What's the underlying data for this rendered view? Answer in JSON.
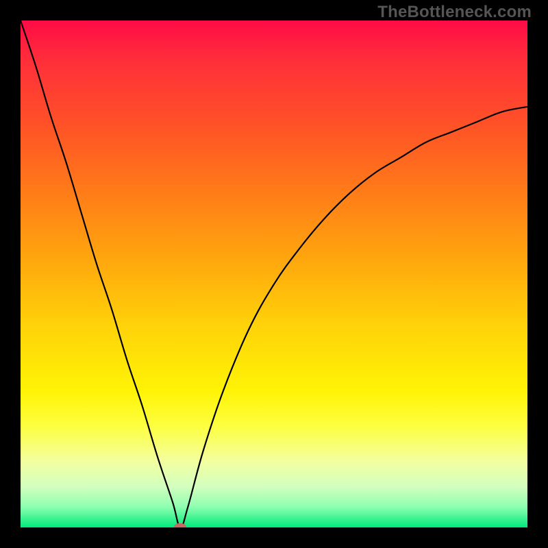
{
  "watermark": "TheBottleneck.com",
  "colors": {
    "frame": "#000000",
    "curve": "#000000",
    "marker": "#c46b62",
    "gradient_top": "#ff0b46",
    "gradient_bottom": "#00e97a"
  },
  "chart_data": {
    "type": "line",
    "title": "",
    "xlabel": "",
    "ylabel": "",
    "xlim": [
      0,
      100
    ],
    "ylim": [
      0,
      100
    ],
    "grid": false,
    "legend": null,
    "annotations": [
      {
        "text": "TheBottleneck.com",
        "position": "top-right"
      }
    ],
    "series": [
      {
        "name": "bottleneck-curve",
        "x": [
          0,
          3,
          6,
          9,
          12,
          15,
          18,
          21,
          24,
          27,
          30,
          31.5,
          33,
          36,
          40,
          45,
          50,
          55,
          60,
          65,
          70,
          75,
          80,
          85,
          90,
          95,
          100
        ],
        "values": [
          100,
          91,
          81,
          72,
          62,
          52,
          43,
          33,
          24,
          14,
          5,
          0,
          4,
          15,
          27,
          39,
          48,
          55,
          61,
          66,
          70,
          73,
          76,
          78,
          80,
          82,
          83
        ]
      }
    ],
    "marker": {
      "x": 31.5,
      "y": 0
    }
  }
}
